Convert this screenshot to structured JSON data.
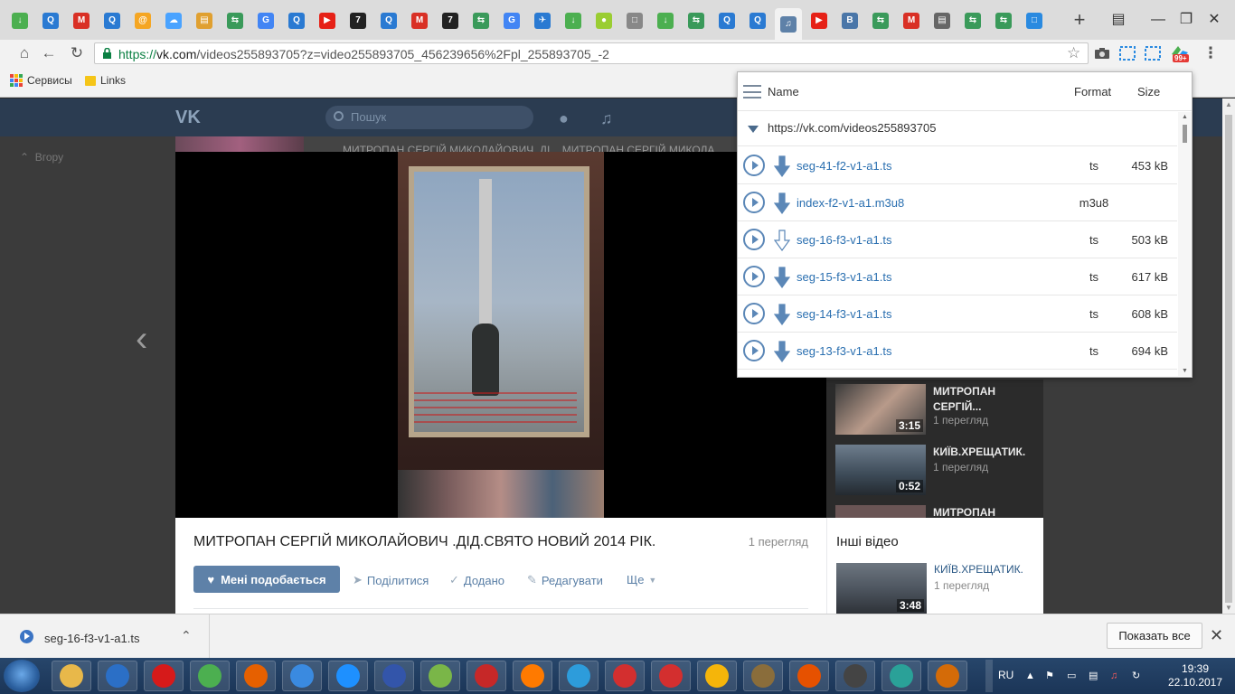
{
  "browser": {
    "url_scheme": "https://",
    "url_host": "vk.com",
    "url_path": "/videos255893705?z=video255893705_456239656%2Fpl_255893705_-2",
    "extension_badge": "99+",
    "bookmarks": [
      {
        "label": "Сервисы"
      },
      {
        "label": "Links"
      }
    ]
  },
  "vk": {
    "search_placeholder": "Пошук",
    "left_nav_label": "Вгору",
    "top_strip_title": "МИТРОПАН СЕРГІЙ МИКОЛАЙОВИЧ .ДІ...   МИТРОПАН СЕРГІЙ МИКОЛА...",
    "video_title": "МИТРОПАН СЕРГІЙ МИКОЛАЙОВИЧ .ДІД.СВЯТО НОВИЙ 2014 РІК.",
    "video_views": "1 перегляд",
    "like_label": "Мені подобається",
    "share_label": "Поділитися",
    "added_label": "Додано",
    "edit_label": "Редагувати",
    "more_label": "Ще",
    "sidebar_videos": [
      {
        "title": "МИТРОПАН СЕРГІЙ...",
        "duration": "3:15",
        "views": "1 перегляд"
      },
      {
        "title": "КИЇВ.ХРЕЩАТИК.",
        "duration": "0:52",
        "views": "1 перегляд"
      },
      {
        "title": "МИТРОПАН",
        "duration": "",
        "views": ""
      }
    ],
    "other_videos_title": "Інші відео",
    "other_videos": [
      {
        "title": "КИЇВ.ХРЕЩАТИК.",
        "duration": "3:48",
        "views": "1 перегляд"
      }
    ]
  },
  "popup": {
    "col_name": "Name",
    "col_format": "Format",
    "col_size": "Size",
    "group_url": "https://vk.com/videos255893705",
    "files": [
      {
        "name": "seg-41-f2-v1-a1.ts",
        "format": "ts",
        "size": "453 kB",
        "downloaded": true
      },
      {
        "name": "index-f2-v1-a1.m3u8",
        "format": "m3u8",
        "size": "",
        "downloaded": true
      },
      {
        "name": "seg-16-f3-v1-a1.ts",
        "format": "ts",
        "size": "503 kB",
        "downloaded": false
      },
      {
        "name": "seg-15-f3-v1-a1.ts",
        "format": "ts",
        "size": "617 kB",
        "downloaded": true
      },
      {
        "name": "seg-14-f3-v1-a1.ts",
        "format": "ts",
        "size": "608 kB",
        "downloaded": true
      },
      {
        "name": "seg-13-f3-v1-a1.ts",
        "format": "ts",
        "size": "694 kB",
        "downloaded": true
      }
    ]
  },
  "downloads": {
    "file": "seg-16-f3-v1-a1.ts",
    "show_all": "Показать все"
  },
  "taskbar": {
    "lang": "RU",
    "time": "19:39",
    "date": "22.10.2017"
  },
  "colors": {
    "vk_header": "#2b3c51",
    "accent_blue": "#5b87b7",
    "link_blue": "#2a6fb0",
    "like_button": "#5e81a8"
  }
}
